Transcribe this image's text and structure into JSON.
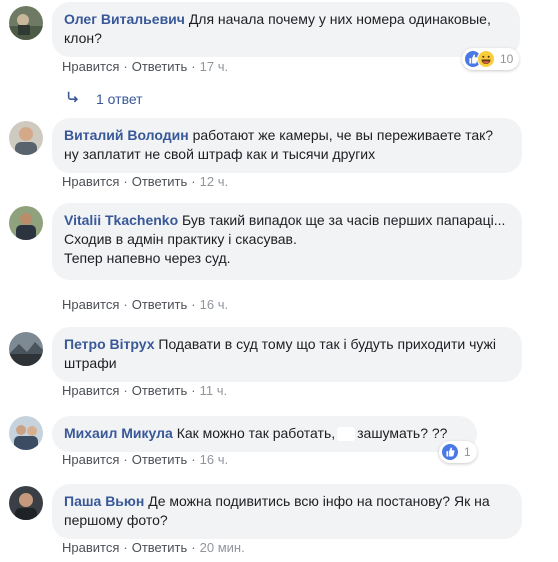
{
  "colors": {
    "link": "#385898",
    "bubble": "#f2f3f5",
    "meta": "#606770",
    "like": "#4a79e6"
  },
  "comments": [
    {
      "author": "Олег Витальевич",
      "text": "Для начала почему у них номера одинаковые, клон?",
      "like": "Нравится",
      "reply": "Ответить",
      "time": "17 ч.",
      "reactions": {
        "icons": [
          "like-icon",
          "haha-icon"
        ],
        "count": "10"
      },
      "replies_label": "1 ответ"
    },
    {
      "author": "Виталий Володин",
      "text": "работают же камеры, че вы переживаете так? ну заплатит не свой штраф как и тысячи других",
      "like": "Нравится",
      "reply": "Ответить",
      "time": "12 ч."
    },
    {
      "author": "Vitalii Tkachenko",
      "text": "Був такий випадок ще за часів перших папараці...\nСходив в адмін практику і скасував.\nТепер напевно через суд.",
      "like": "Нравится",
      "reply": "Ответить",
      "time": "16 ч."
    },
    {
      "author": "Петро Вітрух",
      "text": "Подавати в суд тому що так і будуть приходити чужі штрафи",
      "like": "Нравится",
      "reply": "Ответить",
      "time": "11 ч."
    },
    {
      "author": "Михаил Микула",
      "text_before": "Как можно так работать,",
      "text_after": "зашумать? ??",
      "like": "Нравится",
      "reply": "Ответить",
      "time": "16 ч.",
      "reactions": {
        "icons": [
          "like-icon"
        ],
        "count": "1"
      }
    },
    {
      "author": "Паша Вьюн",
      "text": "Де можна подивитись всю інфо на постанову? Як на першому фото?",
      "like": "Нравится",
      "reply": "Ответить",
      "time": "20 мин."
    }
  ]
}
